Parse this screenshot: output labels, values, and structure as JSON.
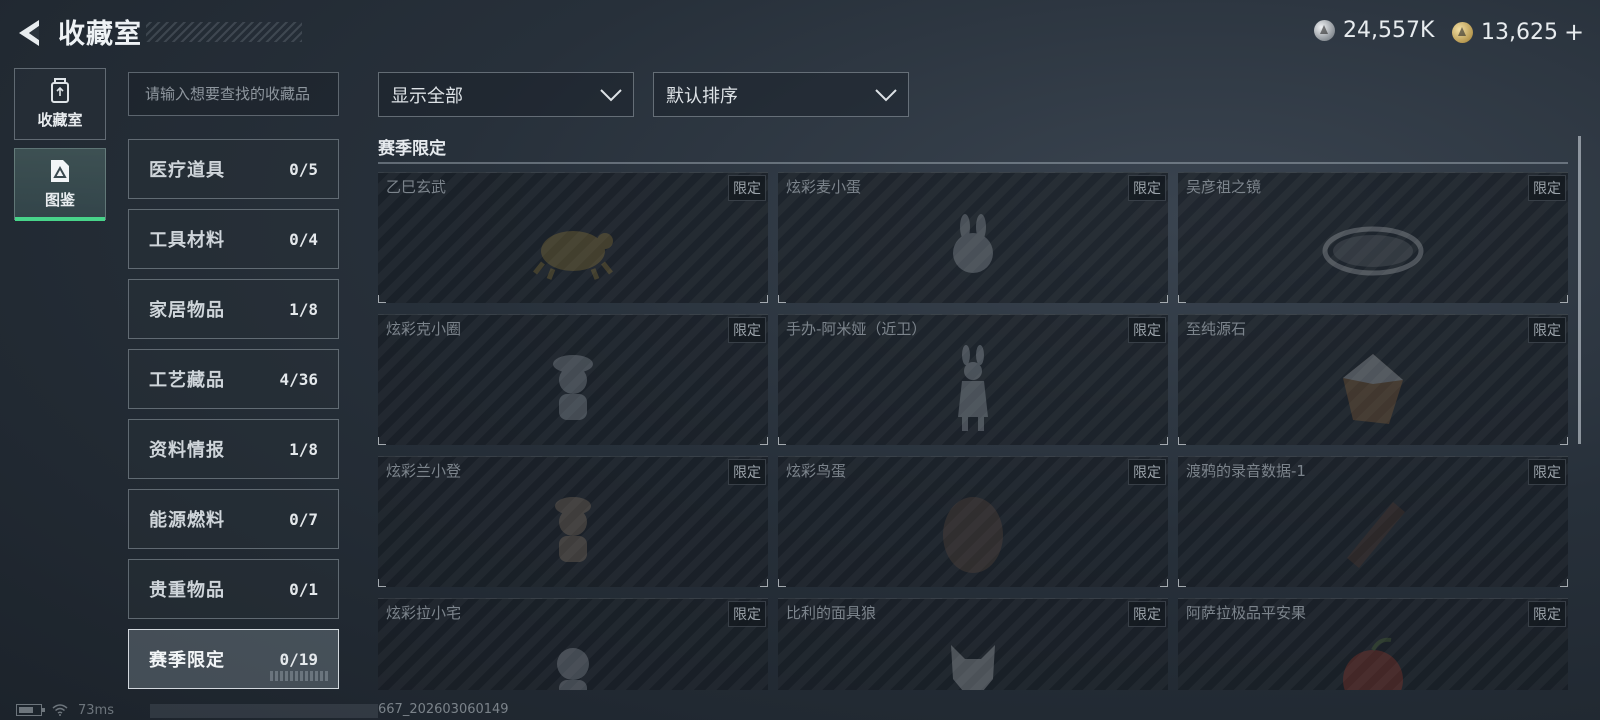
{
  "header": {
    "title": "收藏室",
    "currency_silver": "24,557K",
    "currency_gold": "13,625",
    "gold_plus": "+"
  },
  "side_nav": {
    "items": [
      {
        "label": "收藏室",
        "icon": "trash-can-icon"
      },
      {
        "label": "图鉴",
        "icon": "album-icon"
      }
    ],
    "active_index": 1
  },
  "search": {
    "placeholder": "请输入想要查找的收藏品"
  },
  "categories": [
    {
      "label": "医疗道具",
      "count": "0/5"
    },
    {
      "label": "工具材料",
      "count": "0/4"
    },
    {
      "label": "家居物品",
      "count": "1/8"
    },
    {
      "label": "工艺藏品",
      "count": "4/36"
    },
    {
      "label": "资料情报",
      "count": "1/8"
    },
    {
      "label": "能源燃料",
      "count": "0/7"
    },
    {
      "label": "贵重物品",
      "count": "0/1"
    },
    {
      "label": "赛季限定",
      "count": "0/19"
    }
  ],
  "active_category_index": 7,
  "filters": {
    "show_label": "显示全部",
    "sort_label": "默认排序"
  },
  "section": {
    "title": "赛季限定"
  },
  "items": [
    {
      "name": "乙巳玄武",
      "tag": "限定",
      "icon": "turtle-icon"
    },
    {
      "name": "炫彩麦小蛋",
      "tag": "限定",
      "icon": "rabbit-figure-icon"
    },
    {
      "name": "吴彦祖之镜",
      "tag": "限定",
      "icon": "mirror-icon"
    },
    {
      "name": "炫彩克小圈",
      "tag": "限定",
      "icon": "figure-icon"
    },
    {
      "name": "手办-阿米娅（近卫）",
      "tag": "限定",
      "icon": "figurine-icon"
    },
    {
      "name": "至纯源石",
      "tag": "限定",
      "icon": "crystal-icon"
    },
    {
      "name": "炫彩兰小登",
      "tag": "限定",
      "icon": "figure-icon"
    },
    {
      "name": "炫彩鸟蛋",
      "tag": "限定",
      "icon": "egg-icon"
    },
    {
      "name": "渡鸦的录音数据-1",
      "tag": "限定",
      "icon": "recorder-icon"
    },
    {
      "name": "炫彩拉小宅",
      "tag": "限定",
      "icon": "figure-icon"
    },
    {
      "name": "比利的面具狼",
      "tag": "限定",
      "icon": "wolf-mask-icon"
    },
    {
      "name": "阿萨拉极品平安果",
      "tag": "限定",
      "icon": "apple-icon"
    }
  ],
  "status": {
    "ping": "73ms",
    "uid_suffix": "667_202603060149"
  }
}
